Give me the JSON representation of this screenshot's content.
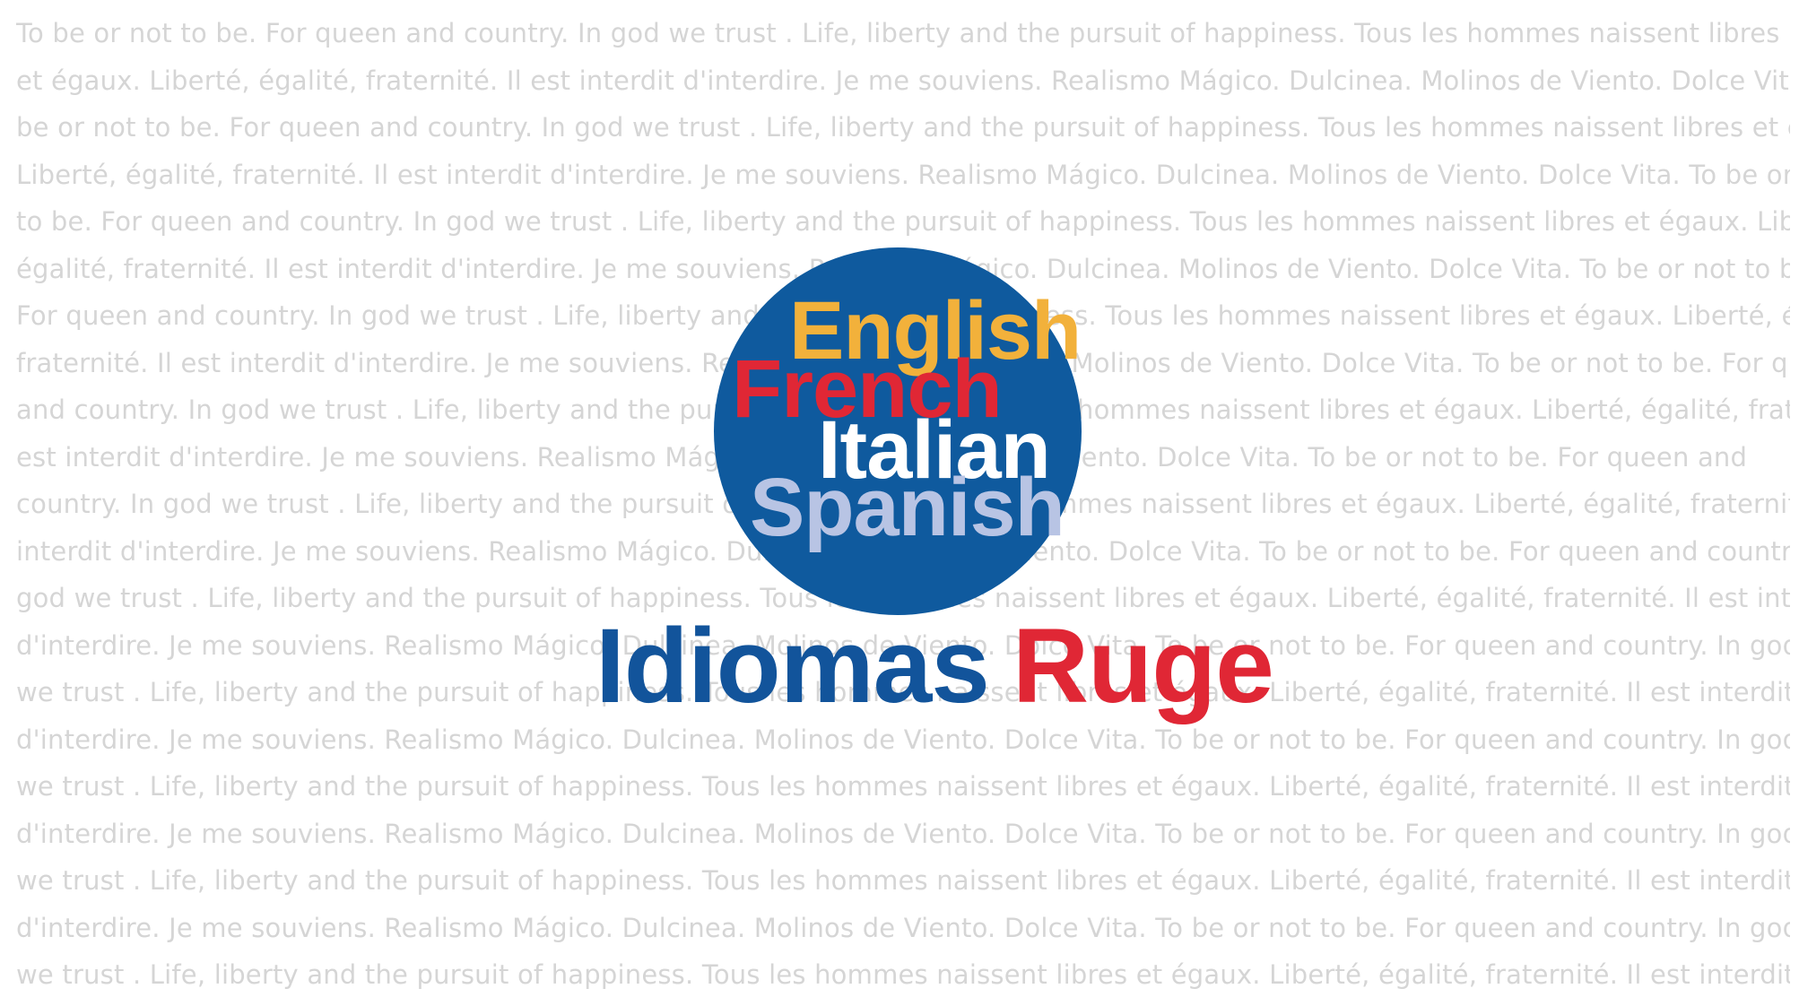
{
  "background_text": {
    "lines": [
      "To be or not to be. For queen and country. In god we trust . Life, liberty and the pursuit of happiness. Tous les hommes naissent libres",
      "et  égaux. Liberté, égalité, fraternité. Il est interdit d'interdire. Je me souviens. Realismo Mágico. Dulcinea. Molinos de Viento. Dolce Vita.  To",
      "be or not to be. For queen and country. In god we trust . Life, liberty and the pursuit of happiness. Tous les hommes naissent libres et  égaux.",
      "Liberté, égalité, fraternité. Il est interdit d'interdire. Je me souviens. Realismo Mágico. Dulcinea. Molinos de Viento. Dolce Vita. To be or not",
      "to be. For queen and country. In god we trust . Life, liberty and the pursuit of happiness. Tous les hommes naissent libres et  égaux. Liberté,",
      "égalité, fraternité. Il est interdit d'interdire. Je me souviens. Realismo Mágico. Dulcinea. Molinos de Viento. Dolce Vita.  To be or not to be.",
      "For queen and country. In god we trust . Life, liberty and the pursuit of happiness. Tous les hommes naissent libres et  égaux. Liberté, égalité,",
      "fraternité. Il est interdit d'interdire. Je me souviens. Realismo Mágico. Dulcinea. Molinos de Viento. Dolce Vita.  To be or not to be. For queen",
      "and country. In god we trust . Life, liberty and the pursuit of happiness. Tous les hommes naissent libres et  égaux. Liberté, égalité, fraternité. Il",
      "est interdit d'interdire. Je me souviens. Realismo Mágico. Dulcinea. Molinos de Viento. Dolce Vita.  To be or not to be. For queen and",
      "country. In god we trust . Life, liberty and the pursuit of happiness. Tous les hommes naissent libres et  égaux. Liberté, égalité, fraternité. Il est",
      "interdit d'interdire. Je me souviens. Realismo Mágico. Dulcinea. Molinos de Viento. Dolce Vita.  To be or not to be. For queen and country. In",
      "god we trust . Life, liberty and the pursuit of happiness. Tous les hommes naissent libres et  égaux. Liberté, égalité, fraternité. Il est interdit",
      "d'interdire. Je me souviens. Realismo Mágico. Dulcinea. Molinos de Viento. Dolce Vita.  To be or not to be. For queen and country. In god",
      "we trust . Life, liberty and the pursuit of happiness. Tous les hommes naissent libres et  égaux. Liberté, égalité, fraternité. Il est interdit",
      "d'interdire. Je me souviens. Realismo Mágico. Dulcinea. Molinos de Viento. Dolce Vita.  To be or not to be. For queen and country. In god",
      "we trust . Life, liberty and the pursuit of happiness. Tous les hommes naissent libres et  égaux. Liberté, égalité, fraternité. Il est interdit",
      "d'interdire. Je me souviens. Realismo Mágico. Dulcinea. Molinos de Viento. Dolce Vita. To be or not to be. For queen and country. In god",
      "we trust . Life, liberty and the pursuit of happiness. Tous les hommes naissent libres et  égaux. Liberté, égalité, fraternité. Il est interdit",
      "d'interdire. Je me souviens. Realismo Mágico. Dulcinea. Molinos de Viento. Dolce Vita.  To be or not to be. For queen and country. In god",
      "we trust . Life, liberty and the pursuit of happiness. Tous les hommes naissent libres et  égaux. Liberté, égalité, fraternité. Il est interdit et  égau"
    ]
  },
  "logo": {
    "languages": [
      "English",
      "French",
      "Italian",
      "Spanish"
    ],
    "brand_word_1": "Idiomas",
    "brand_word_2": "Ruge"
  },
  "colors": {
    "circle": "#0f5a9e",
    "english": "#f2b13b",
    "french": "#e02735",
    "italian": "#ffffff",
    "spanish": "#b8c4e4",
    "brand_blue": "#12549b",
    "brand_red": "#e02735",
    "background_text": "#d5d5d5"
  }
}
